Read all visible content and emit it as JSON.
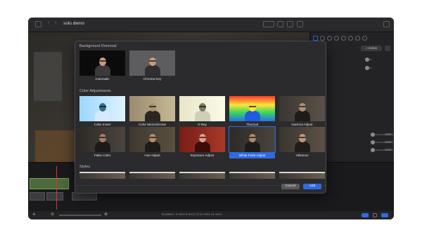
{
  "window": {
    "title": "solo demo"
  },
  "status": {
    "duration": "Duration: 3 mins 8 secs of 11 mins 41 secs"
  },
  "inspector": {
    "action_button": "+ Action",
    "values": [
      "0",
      "0",
      "100%",
      "100%",
      "100%"
    ]
  },
  "popup": {
    "sections": {
      "background_removal": "Background Removal",
      "color_adjustments": "Color Adjustments",
      "styles": "Styles"
    },
    "background_effects": [
      {
        "label": "Automatic"
      },
      {
        "label": "Chroma Key"
      }
    ],
    "color_effects_row1": [
      {
        "label": "Color Invert"
      },
      {
        "label": "Color Monochrome"
      },
      {
        "label": "X-Ray"
      },
      {
        "label": "Thermal"
      },
      {
        "label": "Gamma Adjust"
      }
    ],
    "color_effects_row2": [
      {
        "label": "False Color"
      },
      {
        "label": "Hue Adjust"
      },
      {
        "label": "Exposure Adjust"
      },
      {
        "label": "White Point Adjust",
        "selected": true
      },
      {
        "label": "Vibrance"
      }
    ],
    "buttons": {
      "cancel": "Cancel",
      "add": "Add"
    }
  },
  "colors": {
    "accent": "#2f6be0",
    "playhead": "#e0322c"
  }
}
